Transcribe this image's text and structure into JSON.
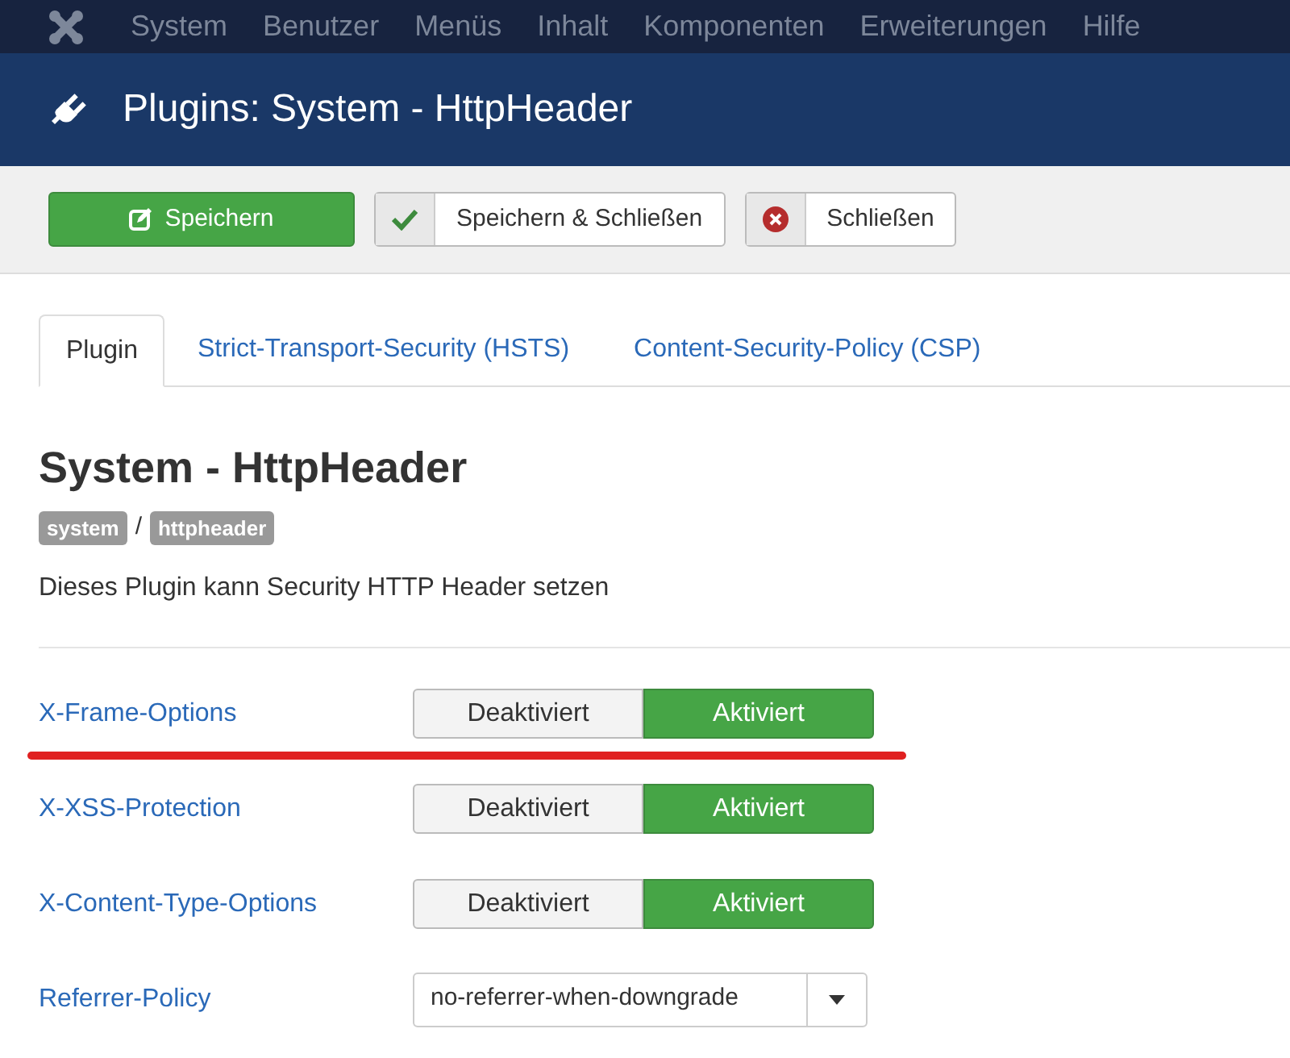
{
  "menu": [
    "System",
    "Benutzer",
    "Menüs",
    "Inhalt",
    "Komponenten",
    "Erweiterungen",
    "Hilfe"
  ],
  "header": {
    "title": "Plugins: System - HttpHeader"
  },
  "toolbar": [
    {
      "kind": "save",
      "label": "Speichern"
    },
    {
      "kind": "save-close",
      "label": "Speichern & Schließen"
    },
    {
      "kind": "close",
      "label": "Schließen"
    }
  ],
  "tabs": [
    {
      "label": "Plugin",
      "selected": true
    },
    {
      "label": "Strict-Transport-Security (HSTS)",
      "selected": false
    },
    {
      "label": "Content-Security-Policy (CSP)",
      "selected": false
    }
  ],
  "plugin": {
    "title": "System - HttpHeader",
    "badges": [
      "system",
      "httpheader"
    ],
    "separator": "/",
    "description": "Dieses Plugin kann Security HTTP Header setzen"
  },
  "fields": [
    {
      "kind": "toggle",
      "label": "X-Frame-Options",
      "underlined": true,
      "options": [
        {
          "label": "Deaktiviert",
          "selected": false
        },
        {
          "label": "Aktiviert",
          "selected": true
        }
      ]
    },
    {
      "kind": "toggle",
      "label": "X-XSS-Protection",
      "underlined": false,
      "options": [
        {
          "label": "Deaktiviert",
          "selected": false
        },
        {
          "label": "Aktiviert",
          "selected": true
        }
      ]
    },
    {
      "kind": "toggle",
      "label": "X-Content-Type-Options",
      "underlined": false,
      "options": [
        {
          "label": "Deaktiviert",
          "selected": false
        },
        {
          "label": "Aktiviert",
          "selected": true
        }
      ]
    },
    {
      "kind": "select",
      "label": "Referrer-Policy",
      "underlined": false,
      "value": "no-referrer-when-downgrade"
    }
  ]
}
